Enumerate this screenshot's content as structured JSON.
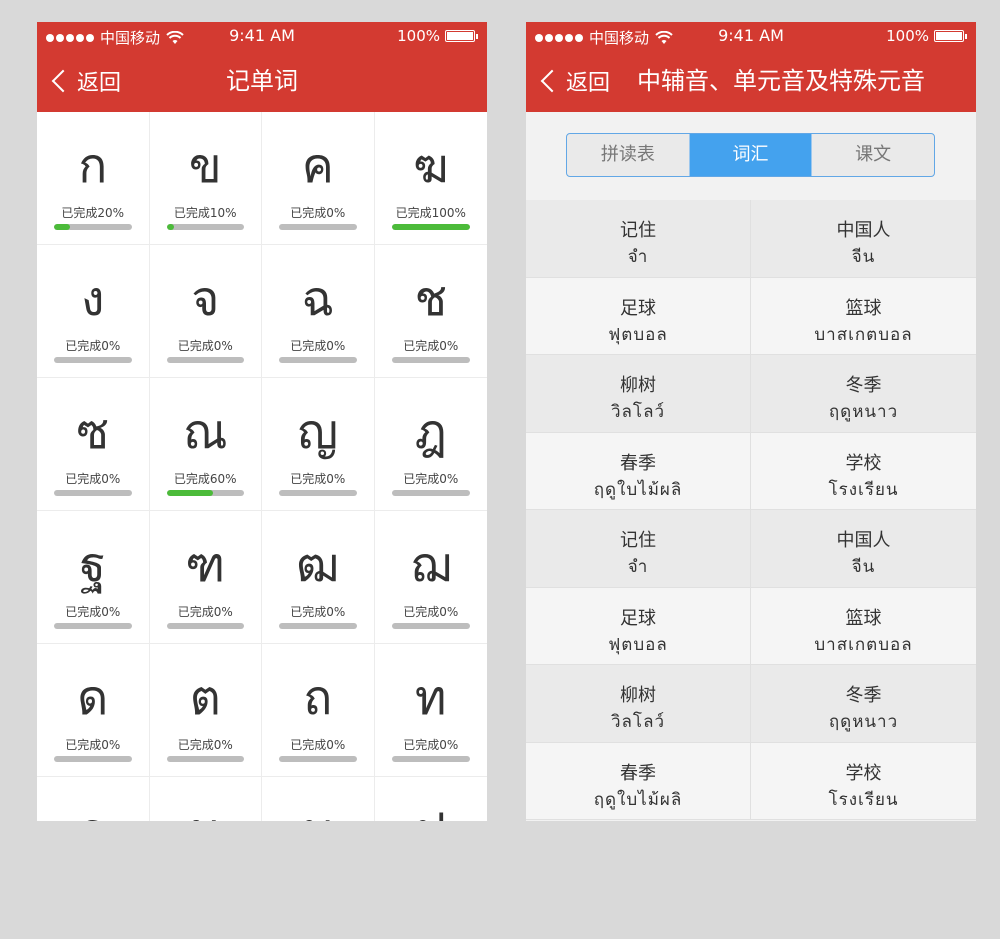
{
  "status": {
    "carrier": "中国移动",
    "time": "9:41 AM",
    "battery": "100%"
  },
  "left": {
    "back_label": "返回",
    "title": "记单词",
    "letters": [
      {
        "char": "ก",
        "progress_label": "已完成20%",
        "progress": 20
      },
      {
        "char": "ข",
        "progress_label": "已完成10%",
        "progress": 10
      },
      {
        "char": "ค",
        "progress_label": "已完成0%",
        "progress": 0
      },
      {
        "char": "ฆ",
        "progress_label": "已完成100%",
        "progress": 100
      },
      {
        "char": "ง",
        "progress_label": "已完成0%",
        "progress": 0
      },
      {
        "char": "จ",
        "progress_label": "已完成0%",
        "progress": 0
      },
      {
        "char": "ฉ",
        "progress_label": "已完成0%",
        "progress": 0
      },
      {
        "char": "ช",
        "progress_label": "已完成0%",
        "progress": 0
      },
      {
        "char": "ซ",
        "progress_label": "已完成0%",
        "progress": 0
      },
      {
        "char": "ณ",
        "progress_label": "已完成60%",
        "progress": 60
      },
      {
        "char": "ญ",
        "progress_label": "已完成0%",
        "progress": 0
      },
      {
        "char": "ฎ",
        "progress_label": "已完成0%",
        "progress": 0
      },
      {
        "char": "ฐ",
        "progress_label": "已完成0%",
        "progress": 0
      },
      {
        "char": "ฑ",
        "progress_label": "已完成0%",
        "progress": 0
      },
      {
        "char": "ฒ",
        "progress_label": "已完成0%",
        "progress": 0
      },
      {
        "char": "ฌ",
        "progress_label": "已完成0%",
        "progress": 0
      },
      {
        "char": "ด",
        "progress_label": "已完成0%",
        "progress": 0
      },
      {
        "char": "ต",
        "progress_label": "已完成0%",
        "progress": 0
      },
      {
        "char": "ถ",
        "progress_label": "已完成0%",
        "progress": 0
      },
      {
        "char": "ท",
        "progress_label": "已完成0%",
        "progress": 0
      },
      {
        "char": "ธ",
        "progress_label": "",
        "progress": 0
      },
      {
        "char": "น",
        "progress_label": "",
        "progress": 0
      },
      {
        "char": "บ",
        "progress_label": "",
        "progress": 0
      },
      {
        "char": "ป",
        "progress_label": "",
        "progress": 0
      }
    ]
  },
  "right": {
    "back_label": "返回",
    "title": "中辅音、单元音及特殊元音",
    "tabs": [
      {
        "label": "拼读表",
        "active": false
      },
      {
        "label": "词汇",
        "active": true
      },
      {
        "label": "课文",
        "active": false
      }
    ],
    "words": [
      {
        "zh": "记住",
        "th": "จำ"
      },
      {
        "zh": "中国人",
        "th": "จีน"
      },
      {
        "zh": "足球",
        "th": "ฟุตบอล"
      },
      {
        "zh": "篮球",
        "th": "บาสเกตบอล"
      },
      {
        "zh": "柳树",
        "th": "วิลโลว์"
      },
      {
        "zh": "冬季",
        "th": "ฤดูหนาว"
      },
      {
        "zh": "春季",
        "th": "ฤดูใบไม้ผลิ"
      },
      {
        "zh": "学校",
        "th": "โรงเรียน"
      },
      {
        "zh": "记住",
        "th": "จำ"
      },
      {
        "zh": "中国人",
        "th": "จีน"
      },
      {
        "zh": "足球",
        "th": "ฟุตบอล"
      },
      {
        "zh": "篮球",
        "th": "บาสเกตบอล"
      },
      {
        "zh": "柳树",
        "th": "วิลโลว์"
      },
      {
        "zh": "冬季",
        "th": "ฤดูหนาว"
      },
      {
        "zh": "春季",
        "th": "ฤดูใบไม้ผลิ"
      },
      {
        "zh": "学校",
        "th": "โรงเรียน"
      }
    ]
  }
}
